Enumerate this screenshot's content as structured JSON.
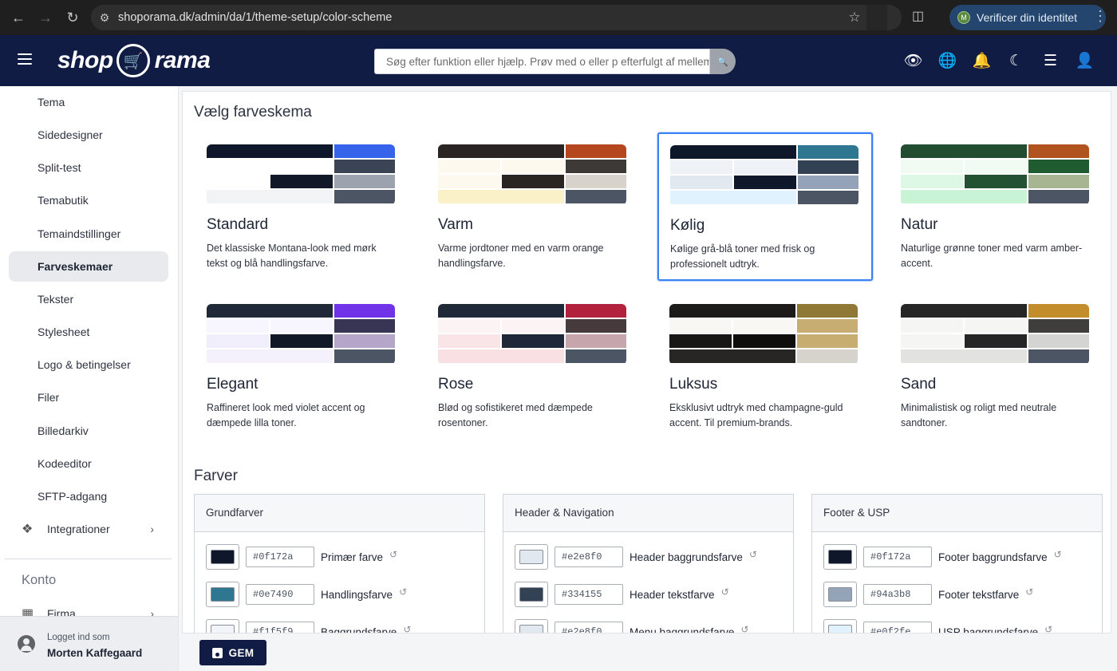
{
  "browser": {
    "url": "shoporama.dk/admin/da/1/theme-setup/color-scheme",
    "verify_label": "Verificer din identitet",
    "verify_avatar": "M"
  },
  "header": {
    "logo_left": "shop",
    "logo_right": "rama",
    "search_placeholder": "Søg efter funktion eller hjælp. Prøv med o eller p efterfulgt af mellemrum"
  },
  "sidebar": {
    "items": [
      {
        "label": "Tema"
      },
      {
        "label": "Sidedesigner"
      },
      {
        "label": "Split-test"
      },
      {
        "label": "Temabutik"
      },
      {
        "label": "Temaindstillinger"
      },
      {
        "label": "Farveskemaer"
      },
      {
        "label": "Tekster"
      },
      {
        "label": "Stylesheet"
      },
      {
        "label": "Logo & betingelser"
      },
      {
        "label": "Filer"
      },
      {
        "label": "Billedarkiv"
      },
      {
        "label": "Kodeeditor"
      },
      {
        "label": "SFTP-adgang"
      },
      {
        "label": "Integrationer"
      }
    ],
    "section_account": "Konto",
    "account_item": "Firma",
    "logged_in_label": "Logget ind som",
    "user_name": "Morten Kaffegaard"
  },
  "main": {
    "title_schemes": "Vælg farveskema",
    "schemes": [
      {
        "name": "Standard",
        "desc": "Det klassiske Montana-look med mørk tekst og blå handlingsfarve.",
        "colors": [
          "#0f172a",
          "#3563e9",
          "#ffffff",
          "#ffffff",
          "#3a4454",
          "#ffffff",
          "#111827",
          "#9ca3af",
          "#f1f3f5",
          "#4b5563"
        ]
      },
      {
        "name": "Varm",
        "desc": "Varme jordtoner med en varm orange handlingsfarve.",
        "colors": [
          "#2a2523",
          "#b5471f",
          "#fdf9ee",
          "#fdf9ee",
          "#3d3936",
          "#fdf9ee",
          "#2a2523",
          "#d8d2cd",
          "#fbf1c9",
          "#4b5563"
        ]
      },
      {
        "name": "Kølig",
        "desc": "Kølige grå-blå toner med frisk og professionelt udtryk.",
        "colors": [
          "#0f172a",
          "#2f7690",
          "#eef2f7",
          "#e2e8f0",
          "#334155",
          "#e2e8f0",
          "#0f172a",
          "#94a3b8",
          "#e0f2fe",
          "#4b5563"
        ]
      },
      {
        "name": "Natur",
        "desc": "Naturlige grønne toner med varm amber-accent.",
        "colors": [
          "#234d30",
          "#b1531f",
          "#f1fbf3",
          "#dcf7e3",
          "#1f5c30",
          "#dcf7e3",
          "#235232",
          "#a8b592",
          "#c8f3d4",
          "#4b5563"
        ]
      },
      {
        "name": "Elegant",
        "desc": "Raffineret look med violet accent og dæmpede lilla toner.",
        "colors": [
          "#1f2937",
          "#7133e8",
          "#f7f5fd",
          "#f0eefb",
          "#383554",
          "#e9e4f9",
          "#111827",
          "#b4a6c9",
          "#f4f1fc",
          "#4b5563"
        ]
      },
      {
        "name": "Rose",
        "desc": "Blød og sofistikeret med dæmpede rosentoner.",
        "colors": [
          "#1f2937",
          "#b3223c",
          "#fcf3f4",
          "#f9e5e7",
          "#463a3c",
          "#fbe1e4",
          "#1e2838",
          "#c6a6ac",
          "#f8e0e3",
          "#4b5563"
        ]
      },
      {
        "name": "Luksus",
        "desc": "Eksklusivt udtryk med champagne-guld accent. Til premium-brands.",
        "colors": [
          "#1c1b1a",
          "#8f7836",
          "#f9f7f3",
          "#181716",
          "#c7ad72",
          "#efe9e0",
          "#0f0e0d",
          "#c8ad70",
          "#282624",
          "#d6d2cc"
        ]
      },
      {
        "name": "Sand",
        "desc": "Minimalistisk og roligt med neutrale sandtoner.",
        "colors": [
          "#262626",
          "#c48d2c",
          "#f5f5f4",
          "#f5f5f4",
          "#403e3c",
          "#f3f3f2",
          "#262626",
          "#d4d4d3",
          "#e2e2e1",
          "#4b5563"
        ]
      }
    ],
    "title_colors": "Farver",
    "groups": [
      {
        "title": "Grundfarver",
        "rows": [
          {
            "hex": "#0f172a",
            "label": "Primær farve"
          },
          {
            "hex": "#0e7490",
            "label": "Handlingsfarve"
          },
          {
            "hex": "#f1f5f9",
            "label": "Baggrundsfarve"
          }
        ]
      },
      {
        "title": "Header & Navigation",
        "rows": [
          {
            "hex": "#e2e8f0",
            "label": "Header baggrundsfarve"
          },
          {
            "hex": "#334155",
            "label": "Header tekstfarve"
          },
          {
            "hex": "#e2e8f0",
            "label": "Menu baggrundsfarve"
          }
        ]
      },
      {
        "title": "Footer & USP",
        "rows": [
          {
            "hex": "#0f172a",
            "label": "Footer baggrundsfarve"
          },
          {
            "hex": "#94a3b8",
            "label": "Footer tekstfarve"
          },
          {
            "hex": "#e0f2fe",
            "label": "USP baggrundsfarve"
          }
        ]
      }
    ],
    "swatch_colors": [
      [
        "#0f172a",
        "#2f7690",
        "#f1f5f9"
      ],
      [
        "#e2e8f0",
        "#334155",
        "#e2e8f0"
      ],
      [
        "#0f172a",
        "#94a3b8",
        "#e0f2fe"
      ]
    ],
    "save_label": "GEM"
  }
}
